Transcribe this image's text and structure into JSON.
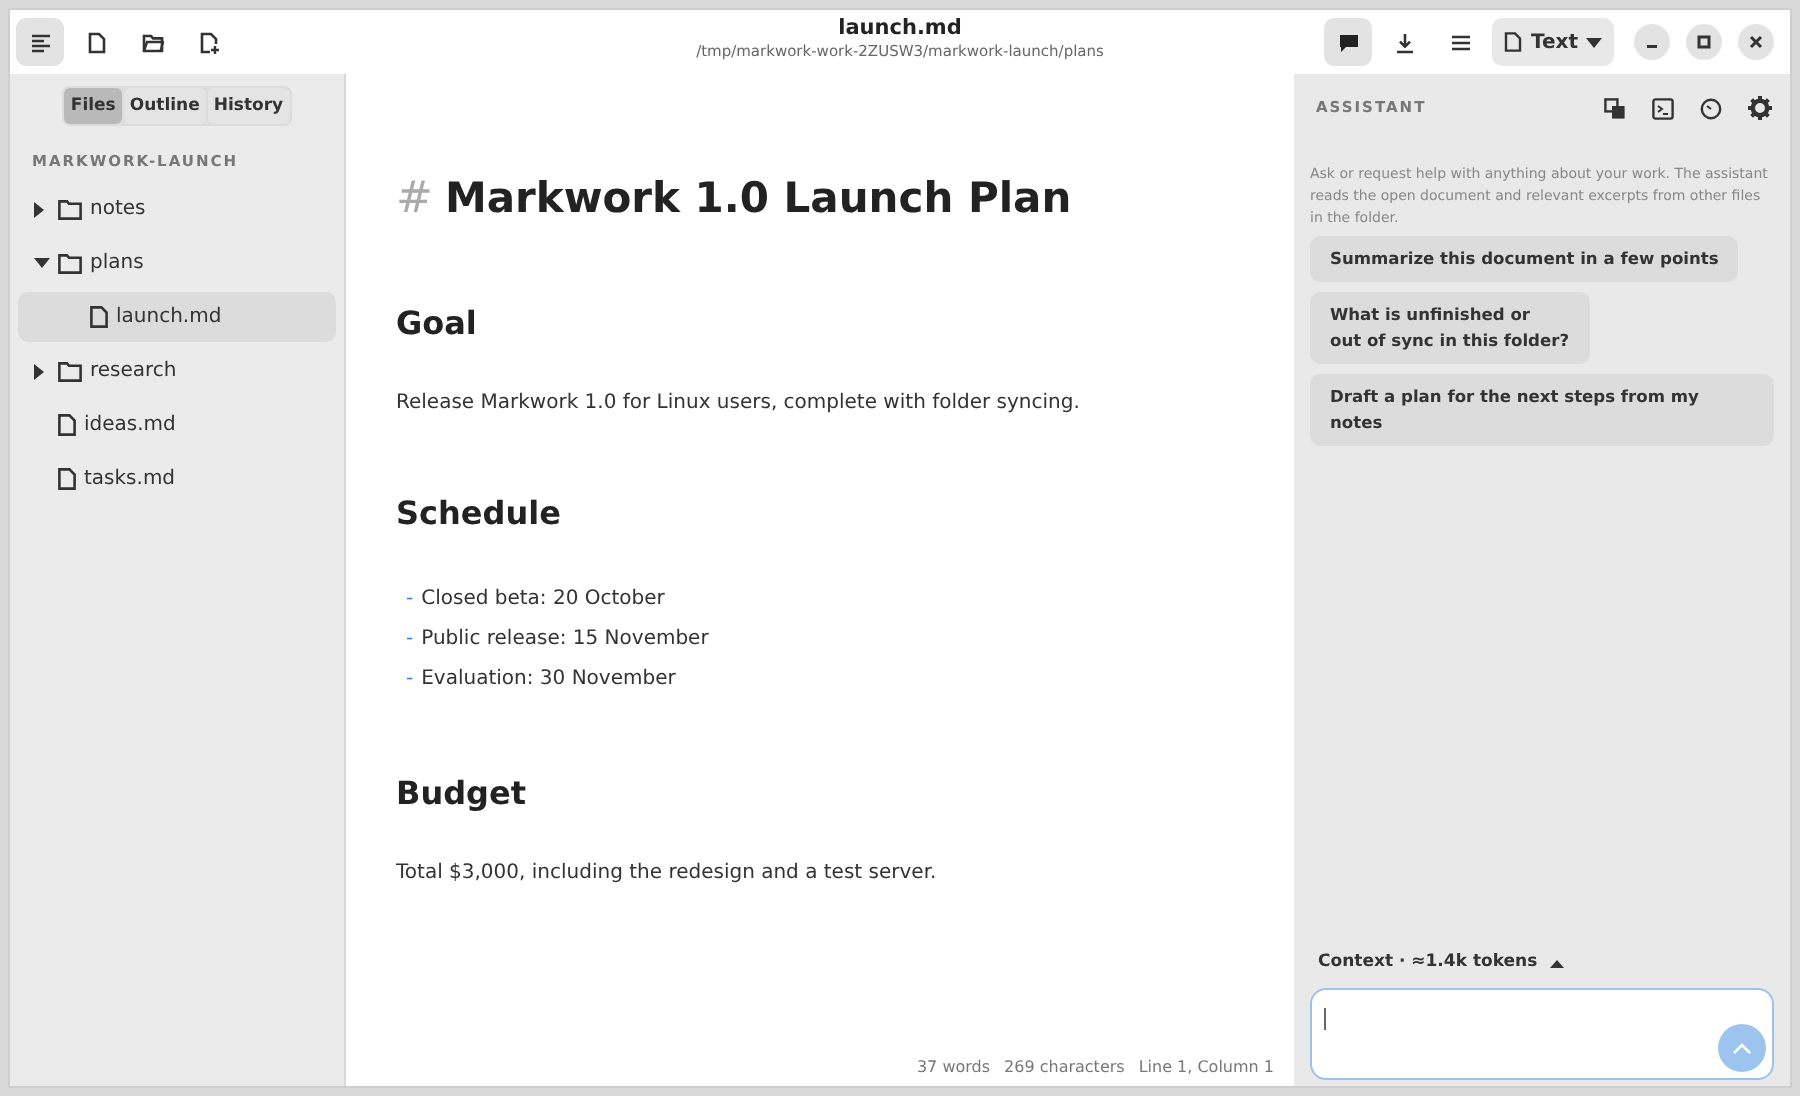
{
  "toolbar_left": [
    {
      "kind": "sidebar",
      "selected": true
    },
    {
      "kind": "new-file",
      "selected": false
    },
    {
      "kind": "open-folder",
      "selected": false
    },
    {
      "kind": "new-document",
      "selected": false
    }
  ],
  "window": {
    "title": "launch.md",
    "path": "/tmp/markwork-work-2ZUSW3/markwork-launch/plans"
  },
  "toolbar_right": [
    {
      "kind": "chat",
      "selected": true
    },
    {
      "kind": "download",
      "selected": false
    },
    {
      "kind": "menu",
      "selected": false
    }
  ],
  "format_dropdown": {
    "label": "Text"
  },
  "sidebar": {
    "tabs": [
      {
        "label": "Files",
        "selected": true
      },
      {
        "label": "Outline",
        "selected": false
      },
      {
        "label": "History",
        "selected": false
      }
    ],
    "folder": "MARKWORK-LAUNCH",
    "items": [
      {
        "kind": "folder",
        "label": "notes",
        "expanded": false
      },
      {
        "kind": "folder",
        "label": "plans",
        "expanded": true,
        "children": [
          {
            "kind": "file",
            "label": "launch.md",
            "selected": true
          }
        ]
      },
      {
        "kind": "folder",
        "label": "research",
        "expanded": false
      },
      {
        "kind": "file",
        "label": "ideas.md",
        "selected": false
      },
      {
        "kind": "file",
        "label": "tasks.md",
        "selected": false
      }
    ]
  },
  "document": [
    {
      "kind": "h1",
      "marker": "#",
      "text": "Markwork 1.0 Launch Plan"
    },
    {
      "kind": "h2",
      "text": "Goal"
    },
    {
      "kind": "p",
      "text": "Release Markwork 1.0 for Linux users, complete with folder syncing."
    },
    {
      "kind": "h2",
      "text": "Schedule"
    },
    {
      "kind": "li",
      "marker": "-",
      "text": "Closed beta: 20 October"
    },
    {
      "kind": "li",
      "marker": "-",
      "text": "Public release: 15 November"
    },
    {
      "kind": "li",
      "marker": "-",
      "text": "Evaluation: 30 November"
    },
    {
      "kind": "h2",
      "text": "Budget"
    },
    {
      "kind": "p",
      "text": "Total $3,000, including the redesign and a test server."
    }
  ],
  "status_bar": [
    "37 words",
    "269 characters",
    "Line 1, Column 1"
  ],
  "assistant": {
    "title": "ASSISTANT",
    "intro": "Ask or request help with anything about your work. The assistant reads the open document and relevant excerpts from other files in the folder.",
    "suggestions": [
      "Summarize this document in a few points",
      "What is unfinished or\nout of sync in this folder?",
      "Draft a plan for the next steps from my notes"
    ],
    "context": "Context · ≈1.4k tokens"
  }
}
